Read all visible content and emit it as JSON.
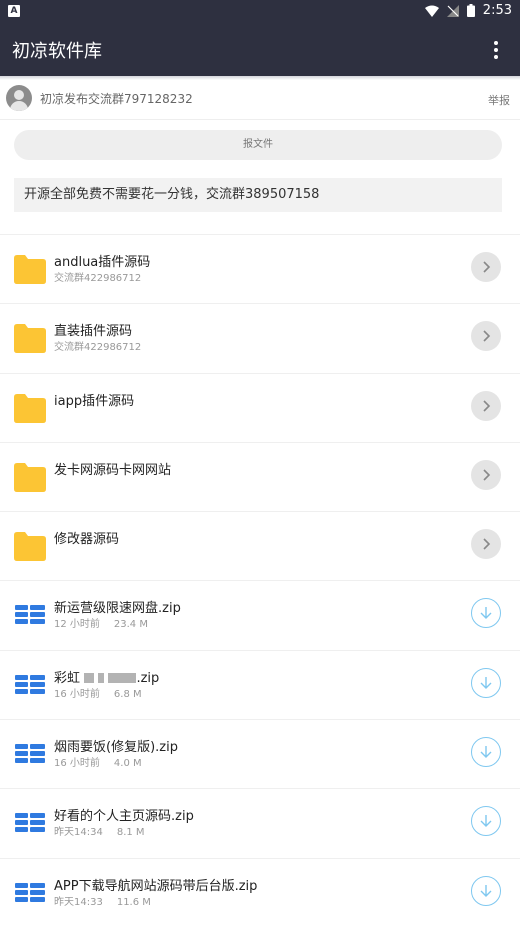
{
  "status_bar": {
    "time": "2:53",
    "app_icon_letter": "A"
  },
  "app_bar": {
    "title": "初凉软件库",
    "menu_icon": "more-vert-icon"
  },
  "sharer": {
    "name": "初凉发布交流群797128232",
    "report_label": "举报"
  },
  "report_file_button": "报文件",
  "notice": "开源全部免费不需要花一分钱，交流群389507158",
  "folders": [
    {
      "name": "andlua插件源码",
      "sub": "交流群422986712"
    },
    {
      "name": "直装插件源码",
      "sub": "交流群422986712"
    },
    {
      "name": "iapp插件源码",
      "sub": ""
    },
    {
      "name": "发卡网源码卡网网站",
      "sub": ""
    },
    {
      "name": "修改器源码",
      "sub": ""
    }
  ],
  "files": [
    {
      "name": "新运营级限速网盘.zip",
      "time": "12 小时前",
      "size": "23.4 M"
    },
    {
      "name": "彩虹",
      "name_suffix": ".zip",
      "time": "16 小时前",
      "size": "6.8 M"
    },
    {
      "name": "烟雨要饭(修复版).zip",
      "time": "16 小时前",
      "size": "4.0 M"
    },
    {
      "name": "好看的个人主页源码.zip",
      "time": "昨天14:34",
      "size": "8.1 M"
    },
    {
      "name": "APP下载导航网站源码带后台版.zip",
      "time": "昨天14:33",
      "size": "11.6 M"
    }
  ],
  "colors": {
    "appbar": "#2e3040",
    "folder": "#fcc534",
    "file_icon": "#2f7ae0",
    "download": "#7fc8f0"
  }
}
